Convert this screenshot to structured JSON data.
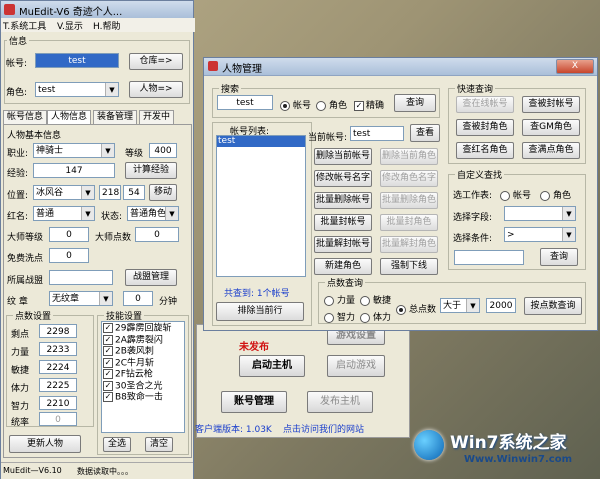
{
  "main_window": {
    "title": "MuEdit-V6  奇迹个人...",
    "menu": [
      "T.系统工具",
      "V.显示",
      "H.帮助"
    ],
    "info_group": "信息",
    "account_label": "帐号:",
    "account_value": "test",
    "warehouse_button": "仓库=>",
    "role_label": "角色:",
    "role_value": "test",
    "character_button": "人物=>",
    "tabs": [
      "帐号信息",
      "人物信息",
      "装备管理",
      "开发中"
    ],
    "basic_group": "人物基本信息",
    "class_label": "职业:",
    "class_value": "神骑士",
    "level_label": "等级",
    "level_value": "400",
    "exp_label": "经验:",
    "exp_value": "147",
    "calc_exp_button": "计算经验",
    "pos_label": "位置:",
    "map_value": "冰风谷",
    "pos_x": "218",
    "pos_y": "54",
    "move_button": "移动",
    "red_label": "红名:",
    "red_value": "普通",
    "state_label": "状态:",
    "state_value": "普通角色",
    "master_label": "大师等级",
    "master_value": "0",
    "master_points_label": "大师点数",
    "master_points_value": "0",
    "free_wash_label": "免费洗点",
    "free_wash_value": "0",
    "guild_label": "所属战盟",
    "guild_button": "战盟管理",
    "badge_label": "纹     章",
    "badge_value": "无纹章",
    "minutes_value": "0",
    "minutes_label": "分钟",
    "points_group": "点数设置",
    "stats": [
      {
        "label": "剩点",
        "value": "2298"
      },
      {
        "label": "力量",
        "value": "2233"
      },
      {
        "label": "敏捷",
        "value": "2224"
      },
      {
        "label": "体力",
        "value": "2225"
      },
      {
        "label": "智力",
        "value": "2210"
      },
      {
        "label": "统率",
        "value": "0"
      }
    ],
    "skills_group": "技能设置",
    "skills": [
      "29霹雳回旋斩",
      "2A霹雳裂闪",
      "2B袭风刺",
      "2C牛月斩",
      "2F钻云枪",
      "30圣合之光",
      "B8致命一击"
    ],
    "select_all_button": "全选",
    "clear_button": "清空",
    "update_button": "更新人物",
    "status_bar_left": "MuEdit—V6.10",
    "status_bar_right": "数据读取中。。。"
  },
  "dialog": {
    "title": "人物管理",
    "close_label": "X",
    "search_group": "搜索",
    "search_value": "test",
    "radio_account": "帐号",
    "radio_role": "角色",
    "exact_label": "精确",
    "query_button": "查询",
    "account_list_label": "帐号列表:",
    "account_list": [
      "test"
    ],
    "found_text": "共查到: 1个帐号",
    "delete_current_button": "排除当前行",
    "current_account_label": "当前帐号:",
    "current_account_value": "test",
    "view_button": "查看",
    "left_buttons": [
      "删除当前帐号",
      "修改帐号名字",
      "批量删除帐号",
      "批量封帐号",
      "批量解封帐号",
      "新建角色"
    ],
    "right_buttons": [
      "删除当前角色",
      "修改角色名字",
      "批量删除角色",
      "批量封角色",
      "批量解封角色",
      "强制下线"
    ],
    "quick_group": "快速查询",
    "quick_buttons": [
      "查在线帐号",
      "查被封帐号",
      "查被封角色",
      "查GM角色",
      "查红名角色",
      "查满点角色"
    ],
    "custom_group": "自定义查找",
    "select_table_label": "选工作表:",
    "select_field_label": "选择字段:",
    "select_cond_label": "选择条件:",
    "cond_value": ">",
    "custom_query_button": "查询",
    "points_query_group": "点数查询",
    "points_radios": [
      "力量",
      "敏捷",
      "智力",
      "体力"
    ],
    "total_label": "总点数",
    "compare_value": "大于",
    "points_value": "2000",
    "points_query_button": "按点数查询"
  },
  "background_window": {
    "unpublished": "未发布",
    "start_host": "启动主机",
    "game_settings": "游戏设置",
    "start_game": "启动游戏",
    "account_mgmt": "账号管理",
    "publish_host": "发布主机",
    "client_version": "客户端版本: 1.03K",
    "visit_site": "点击访问我们的网站"
  },
  "watermark": {
    "text": "Win7系统之家",
    "url": "Www.Winwin7.com"
  },
  "colors": {
    "selection": "#3169c6",
    "link_blue": "#1a3ecc",
    "red_text": "#d01010"
  }
}
